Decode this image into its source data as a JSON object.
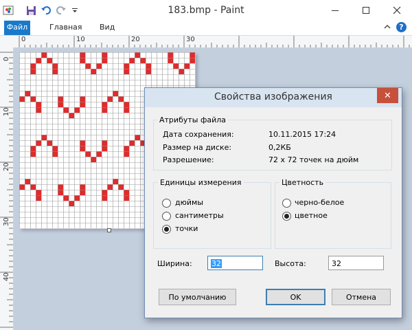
{
  "window": {
    "title": "183.bmp - Paint"
  },
  "quick_access": {
    "icons": [
      "paint-app-icon",
      "save-icon",
      "undo-icon",
      "redo-icon",
      "customize-icon"
    ]
  },
  "ribbon": {
    "tabs": [
      {
        "label": "Файл"
      },
      {
        "label": "Главная"
      },
      {
        "label": "Вид"
      }
    ]
  },
  "rulers": {
    "horizontal": [
      "0",
      "10",
      "20",
      "30"
    ],
    "vertical": [
      "0",
      "10",
      "20",
      "30",
      "40"
    ]
  },
  "pixel_art": {
    "color": "#e02b2b",
    "pattern_note": "red V shapes on 32x32 grid"
  },
  "dialog": {
    "title": "Свойства изображения",
    "close_symbol": "✕",
    "file_attributes": {
      "legend": "Атрибуты файла",
      "rows": [
        {
          "label": "Дата сохранения:",
          "value": "10.11.2015 17:24"
        },
        {
          "label": "Размер на диске:",
          "value": "0,2КБ"
        },
        {
          "label": "Разрешение:",
          "value": "72 x 72 точек на дюйм"
        }
      ]
    },
    "units": {
      "legend": "Единицы измерения",
      "options": [
        {
          "label": "дюймы",
          "selected": false
        },
        {
          "label": "сантиметры",
          "selected": false
        },
        {
          "label": "точки",
          "selected": true
        }
      ]
    },
    "color_mode": {
      "legend": "Цветность",
      "options": [
        {
          "label": "черно-белое",
          "selected": false
        },
        {
          "label": "цветное",
          "selected": true
        }
      ]
    },
    "width": {
      "label": "Ширина:",
      "value": "32"
    },
    "height": {
      "label": "Высота:",
      "value": "32"
    },
    "buttons": {
      "default": "По умолчанию",
      "ok": "OK",
      "cancel": "Отмена"
    }
  }
}
